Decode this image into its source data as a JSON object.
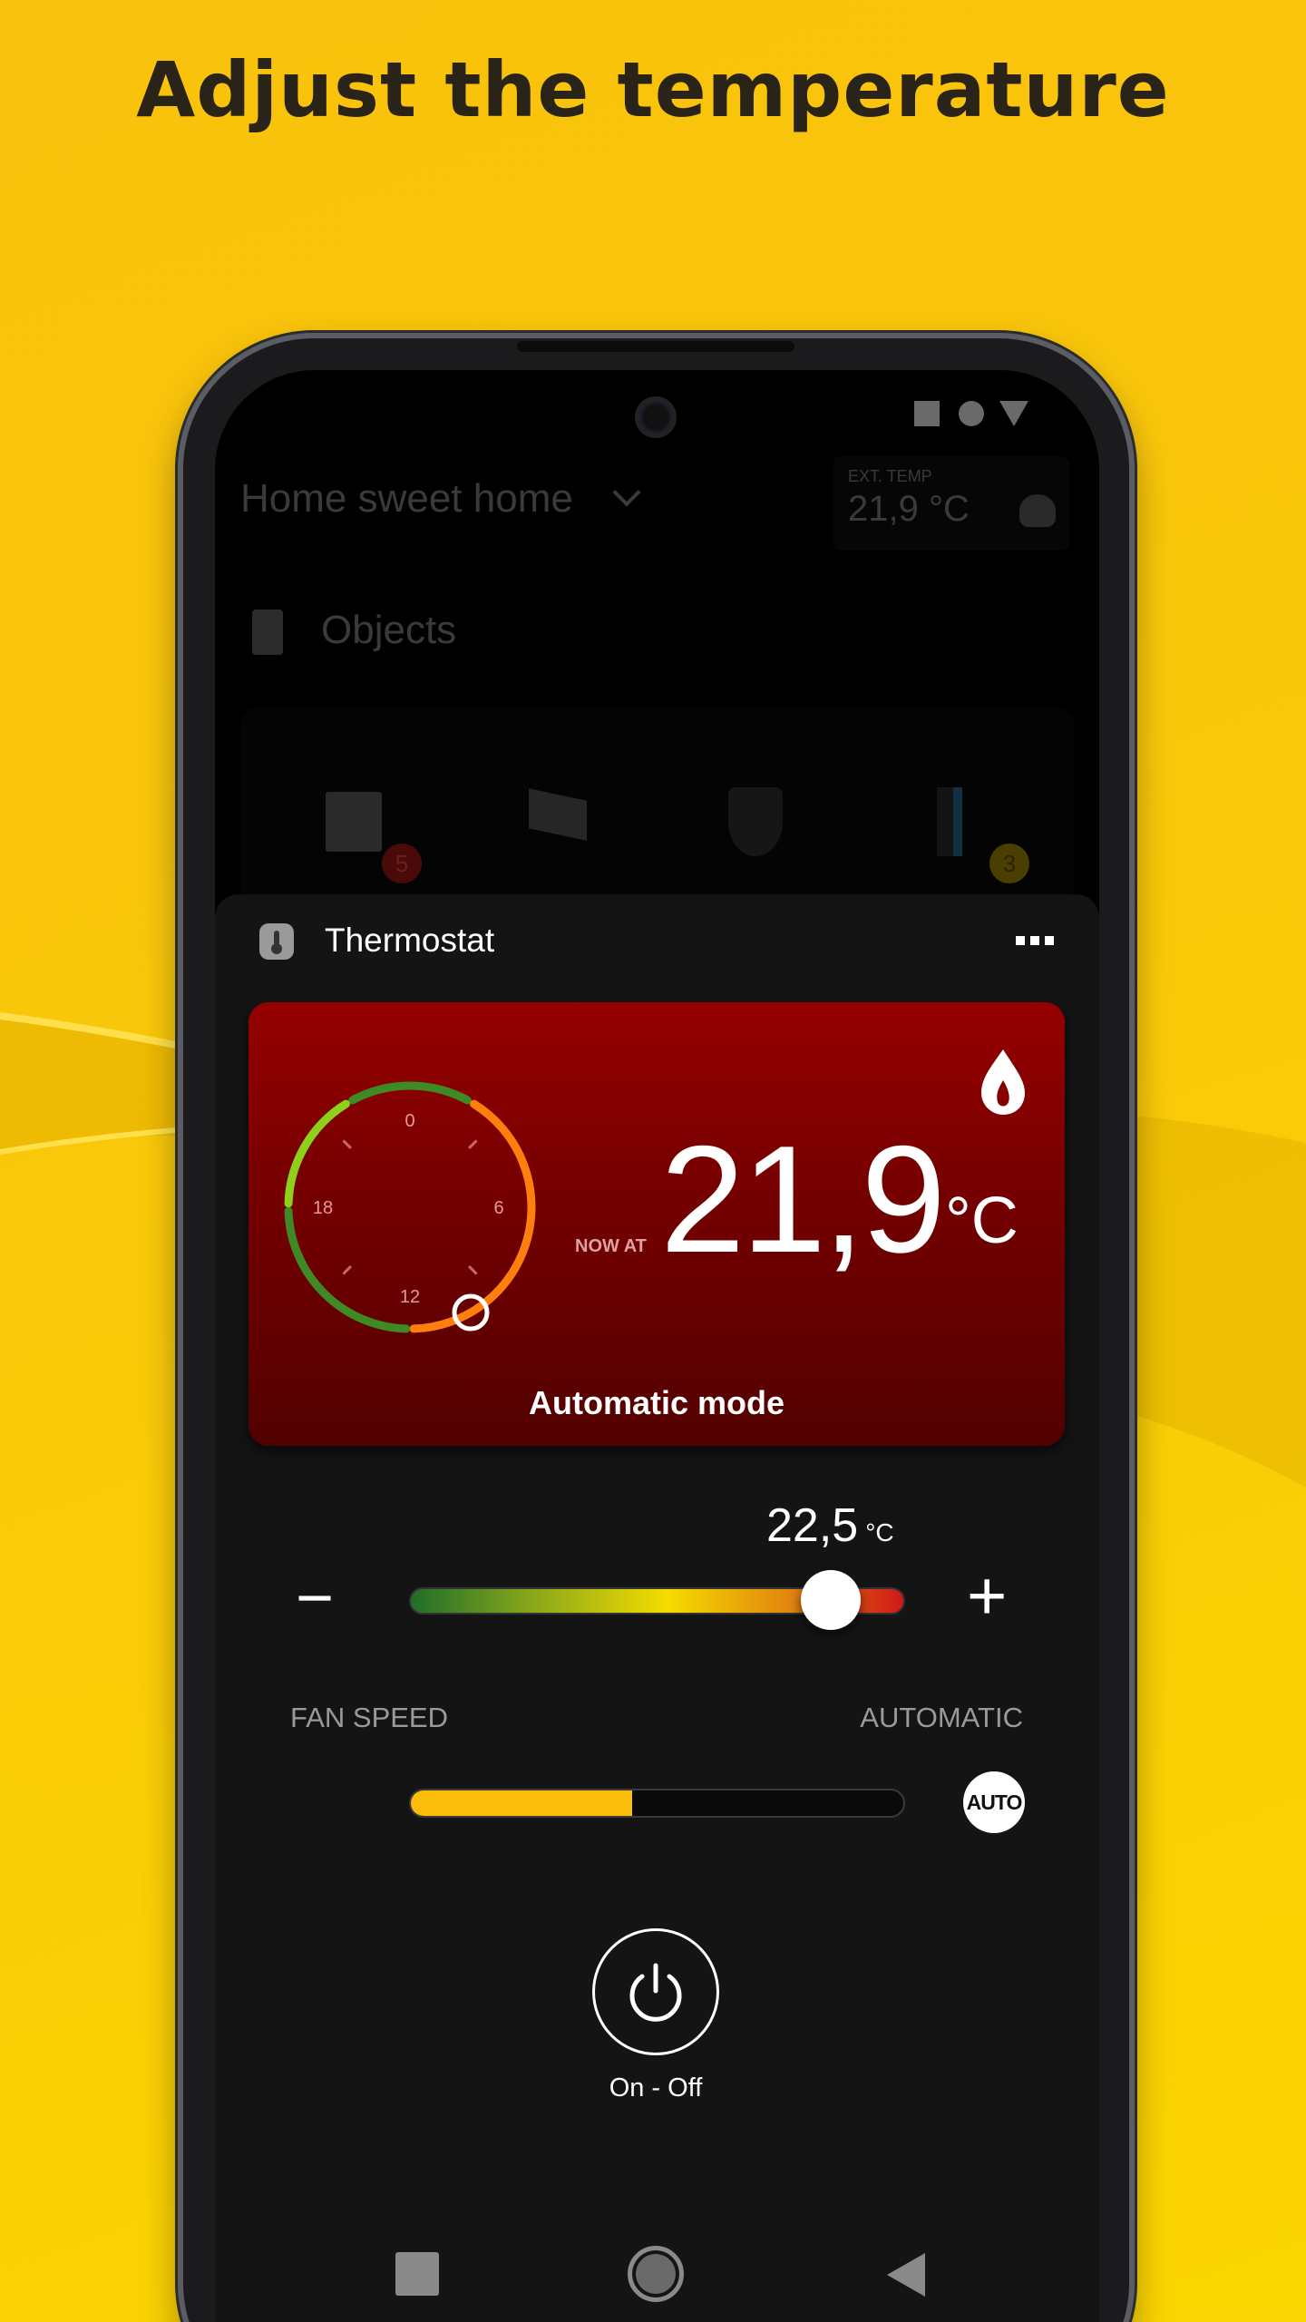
{
  "headline": "Adjust the temperature",
  "background": {
    "from": "#f9c20c",
    "to": "#fcd600"
  },
  "home": {
    "title": "Home sweet home",
    "ext_temp_label": "EXT. TEMP",
    "ext_temp_value": "21,9 °C",
    "weather_icon": "cloudy-night-icon"
  },
  "objects": {
    "title": "Objects",
    "items": [
      {
        "icon": "intercom-icon",
        "badge": "5",
        "badge_color": "#8a1010"
      },
      {
        "icon": "camera-icon"
      },
      {
        "icon": "shield-icon"
      },
      {
        "icon": "door-icon",
        "badge": "3",
        "badge_color": "#8a7200"
      }
    ]
  },
  "thermostat": {
    "title": "Thermostat",
    "menu_icon": "more-icon",
    "heating_icon": "flame-icon",
    "now_label": "NOW AT",
    "current_value": "21,9",
    "unit": "°C",
    "mode": "Automatic mode",
    "dial": {
      "labels": [
        "0",
        "6",
        "12",
        "18"
      ],
      "current_hour": 10,
      "segments": [
        {
          "from": 22,
          "to": 2,
          "color": "#3f8a25"
        },
        {
          "from": 2,
          "to": 12,
          "color": "#ff7f0e"
        },
        {
          "from": 12,
          "to": 18,
          "color": "#3f8a25"
        },
        {
          "from": 18,
          "to": 22,
          "color": "#8ed11a"
        }
      ]
    },
    "setpoint": {
      "value": "22,5",
      "unit": "°C",
      "position": 0.85
    },
    "minus": "−",
    "plus": "+",
    "fan_label": "FAN SPEED",
    "fan_mode": "AUTOMATIC",
    "fan_level": 0.45,
    "fan_color": "#fcbd0b",
    "auto_button": "AUTO",
    "power_label": "On - Off"
  },
  "accent_red": "#950000"
}
